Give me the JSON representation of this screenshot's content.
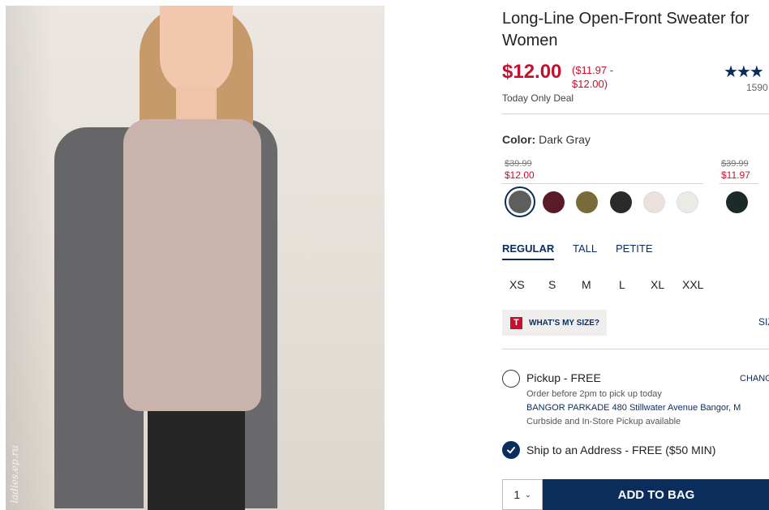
{
  "product": {
    "title": "Long-Line Open-Front Sweater for Women",
    "price": "$12.00",
    "price_range": "($11.97 - $12.00)",
    "deal_label": "Today Only Deal",
    "rating_stars": "★★★",
    "review_count": "1590",
    "photo_watermark": "ladies.ep.ru"
  },
  "color": {
    "label": "Color:",
    "value": "Dark Gray",
    "groups": [
      {
        "original_price": "$39.99",
        "sale_price": "$12.00"
      },
      {
        "original_price": "$39.99",
        "sale_price": "$11.97"
      }
    ],
    "swatches": [
      {
        "name": "dark-gray",
        "hex": "#5e5e5e",
        "selected": true
      },
      {
        "name": "burgundy",
        "hex": "#5a1a2a"
      },
      {
        "name": "olive",
        "hex": "#7a6a3a"
      },
      {
        "name": "black",
        "hex": "#2a2a2a"
      },
      {
        "name": "light-pink",
        "hex": "#eae0dc"
      },
      {
        "name": "cream",
        "hex": "#ebebe6"
      },
      {
        "name": "dark-green",
        "hex": "#1c2b28"
      }
    ]
  },
  "fit_tabs": [
    "REGULAR",
    "TALL",
    "PETITE"
  ],
  "sizes": [
    "XS",
    "S",
    "M",
    "L",
    "XL",
    "XXL"
  ],
  "true_fit": {
    "logo": "T",
    "label": "WHAT'S MY SIZE?"
  },
  "size_chart_label": "SIZ",
  "pickup": {
    "label": "Pickup - FREE",
    "change": "CHANG",
    "order_before": "Order before 2pm to pick up today",
    "store": "BANGOR PARKADE 480 Stillwater Avenue  Bangor, M",
    "note": "Curbside and In-Store Pickup available"
  },
  "ship": {
    "label": "Ship to an Address - FREE ($50 MIN)"
  },
  "quantity": "1",
  "add_to_bag": "ADD TO BAG",
  "colors": {
    "brand_navy": "#0a2d5c",
    "sale_red": "#c8102e"
  }
}
